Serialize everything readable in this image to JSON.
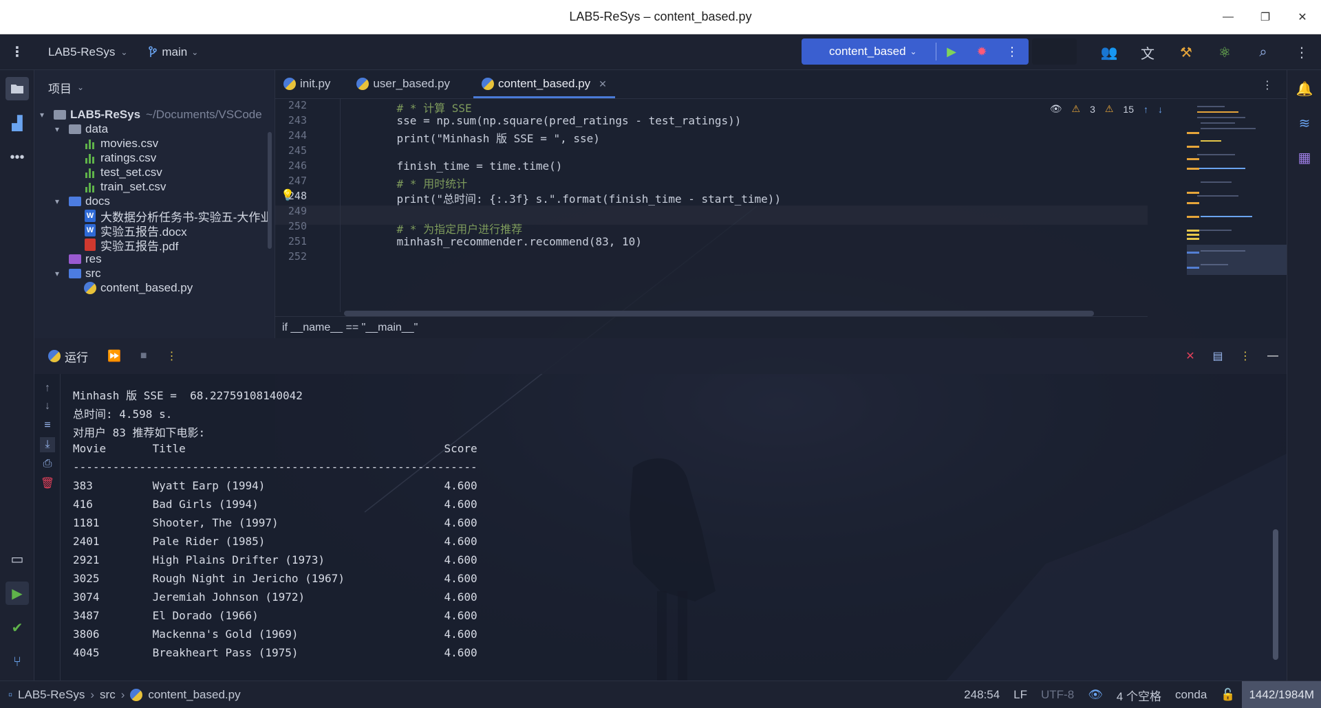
{
  "window": {
    "title": "LAB5-ReSys – content_based.py",
    "buttons": [
      "—",
      "❐",
      "✕"
    ]
  },
  "toolbar": {
    "project": "LAB5-ReSys",
    "branch": "main",
    "run_config": "content_based"
  },
  "project_panel": {
    "header": "项目",
    "tree": [
      {
        "label": "LAB5-ReSys",
        "hint": "~/Documents/VSCode",
        "type": "folder"
      },
      {
        "label": "data",
        "type": "folder"
      },
      {
        "label": "movies.csv",
        "type": "csv"
      },
      {
        "label": "ratings.csv",
        "type": "csv"
      },
      {
        "label": "test_set.csv",
        "type": "csv"
      },
      {
        "label": "train_set.csv",
        "type": "csv"
      },
      {
        "label": "docs",
        "type": "folder"
      },
      {
        "label": "大数据分析任务书-实验五-大作业",
        "type": "doc"
      },
      {
        "label": "实验五报告.docx",
        "type": "doc"
      },
      {
        "label": "实验五报告.pdf",
        "type": "pdf"
      },
      {
        "label": "res",
        "type": "folder"
      },
      {
        "label": "src",
        "type": "folder"
      },
      {
        "label": "content_based.py",
        "type": "py"
      }
    ]
  },
  "editor": {
    "tabs": [
      {
        "label": "init.py"
      },
      {
        "label": "user_based.py"
      },
      {
        "label": "content_based.py",
        "active": true
      }
    ],
    "line_numbers": [
      "242",
      "243",
      "244",
      "245",
      "246",
      "247",
      "248",
      "249",
      "250",
      "251",
      "252"
    ],
    "current_line": "248",
    "lines": [
      "    # * 计算 SSE",
      "    sse = np.sum(np.square(pred_ratings - test_ratings))",
      "    print(\"Minhash 版 SSE = \", sse)",
      "",
      "    finish_time = time.time()",
      "    # * 用时统计",
      "    print(\"总时间: {:.3f} s.\".format(finish_time - start_time))",
      "",
      "    # * 为指定用户进行推荐",
      "    minhash_recommender.recommend(83, 10)",
      ""
    ],
    "inspections": {
      "warnings_a": "3",
      "warnings_b": "15"
    },
    "breadcrumb": "if __name__ == \"__main__\""
  },
  "run_panel": {
    "title": "运行",
    "output": [
      "Minhash 版 SSE =  68.22759108140042",
      "总时间: 4.598 s.",
      "对用户 83 推荐如下电影:",
      "Movie       Title                                       Score",
      "-------------------------------------------------------------",
      "383         Wyatt Earp (1994)                           4.600",
      "416         Bad Girls (1994)                            4.600",
      "1181        Shooter, The (1997)                         4.600",
      "2401        Pale Rider (1985)                           4.600",
      "2921        High Plains Drifter (1973)                  4.600",
      "3025        Rough Night in Jericho (1967)               4.600",
      "3074        Jeremiah Johnson (1972)                     4.600",
      "3487        El Dorado (1966)                            4.600",
      "3806        Mackenna's Gold (1969)                      4.600",
      "4045        Breakheart Pass (1975)                      4.600"
    ]
  },
  "statusbar": {
    "path": [
      "LAB5-ReSys",
      "src",
      "content_based.py"
    ],
    "position": "248:54",
    "line_ending": "LF",
    "encoding": "UTF-8",
    "indent": "4 个空格",
    "interpreter": "conda",
    "memory": "1442/1984M"
  },
  "colors": {
    "accent": "#3a5fd0",
    "warning": "#e6a53a",
    "run_green": "#5fb34a",
    "stop_red": "#e0405a"
  }
}
